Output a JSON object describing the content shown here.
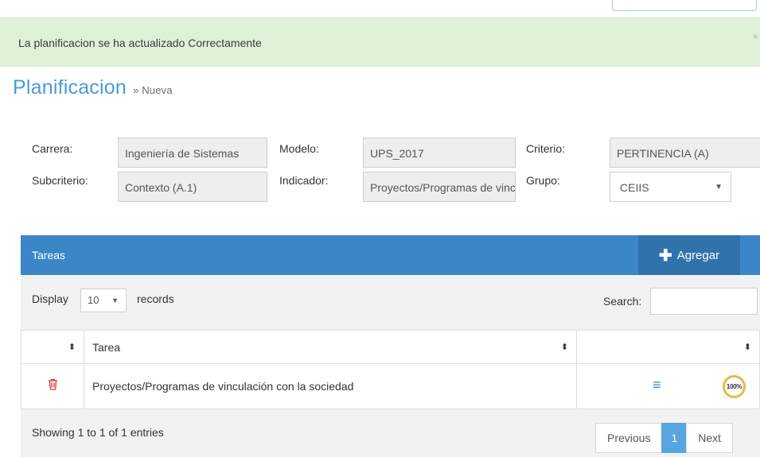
{
  "alert": {
    "message": "La planificacion se ha actualizado Correctamente",
    "close": "×"
  },
  "page": {
    "title": "Planificacion",
    "subtitle": "» Nueva"
  },
  "form": {
    "carrera": {
      "label": "Carrera:",
      "value": "Ingeniería de Sistemas"
    },
    "modelo": {
      "label": "Modelo:",
      "value": "UPS_2017"
    },
    "criterio": {
      "label": "Criterio:",
      "value": "PERTINENCIA (A)"
    },
    "subcriterio": {
      "label": "Subcriterio:",
      "value": "Contexto (A.1)"
    },
    "indicador": {
      "label": "Indicador:",
      "value": "Proyectos/Programas de vinculación con la sociedad"
    },
    "grupo": {
      "label": "Grupo:",
      "value": "CEIIS"
    }
  },
  "panel": {
    "title": "Tareas",
    "add_label": "Agregar"
  },
  "table_controls": {
    "display": "Display",
    "length": "10",
    "records": "records",
    "search_label": "Search:",
    "search_value": ""
  },
  "table": {
    "columns": [
      "",
      "Tarea",
      ""
    ],
    "rows": [
      {
        "tarea": "Proyectos/Programas de vinculación con la sociedad",
        "progress": "100%"
      }
    ]
  },
  "footer": {
    "info": "Showing 1 to 1 of 1 entries",
    "previous": "Previous",
    "page": "1",
    "next": "Next"
  },
  "colors": {
    "header": "#3b86c6",
    "add_button": "#2f72ac",
    "alert_bg": "#dff0d8",
    "title": "#4c9bd6",
    "progress_ring": "#e8b84a",
    "trash": "#e0382f"
  },
  "icons": {
    "add": "plus-icon",
    "delete": "trash-icon",
    "menu": "list-icon",
    "sort": "sort-icon",
    "select": "chevron-down-icon"
  }
}
